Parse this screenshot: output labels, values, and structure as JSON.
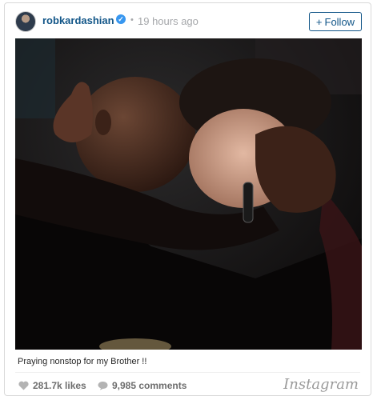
{
  "header": {
    "username": "robkardashian",
    "separator": "•",
    "timestamp": "19 hours ago",
    "follow_label": "Follow",
    "follow_icon": "+"
  },
  "post": {
    "image_icon": "photo",
    "caption": "Praying nonstop for my Brother !!"
  },
  "footer": {
    "likes": "281.7k likes",
    "comments": "9,985 comments",
    "brand": "Instagram"
  },
  "colors": {
    "link": "#125688",
    "muted": "#a5a7aa",
    "verified": "#3897f0"
  }
}
